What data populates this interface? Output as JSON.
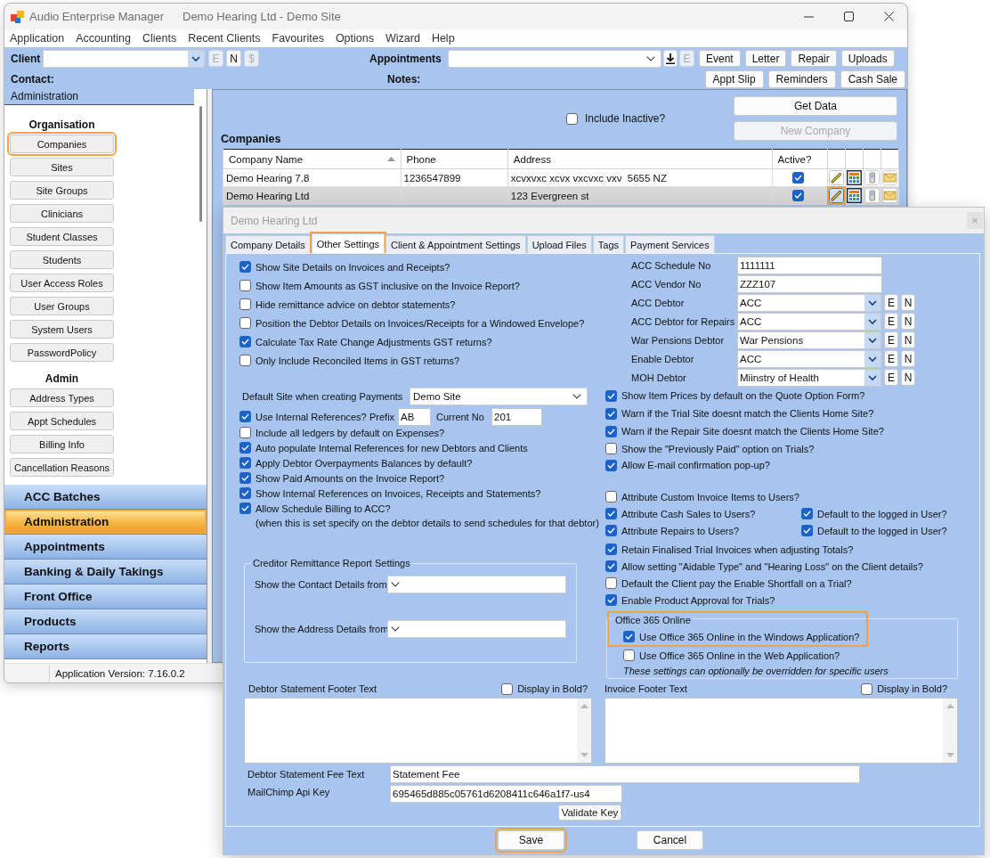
{
  "main_window": {
    "app_title": "Audio Enterprise Manager",
    "document_title": "Demo Hearing Ltd - Demo Site"
  },
  "menu": [
    "Application",
    "Accounting",
    "Clients",
    "Recent Clients",
    "Favourites",
    "Options",
    "Wizard",
    "Help"
  ],
  "toolbar": {
    "client_label": "Client",
    "client_buttons": [
      {
        "label": "E",
        "disabled": true
      },
      {
        "label": "N",
        "disabled": false
      },
      {
        "label": "$",
        "disabled": true
      }
    ],
    "appointments_label": "Appointments",
    "appointment_buttons": [
      {
        "kind": "download",
        "disabled": false
      },
      {
        "kind": "letter",
        "label": "E",
        "disabled": true
      }
    ],
    "buttons": [
      "Event",
      "Letter",
      "Repair",
      "Uploads"
    ],
    "contact_label": "Contact:",
    "notes_label": "Notes:",
    "buttons_row_2": [
      "Appt Slip",
      "Reminders",
      "Cash Sale"
    ]
  },
  "sidebar": {
    "header": "Administration",
    "groups": [
      {
        "heading": "Organisation",
        "items": [
          {
            "label": "Companies",
            "highlighted": true
          },
          {
            "label": "Sites",
            "highlighted": false
          },
          {
            "label": "Site Groups",
            "highlighted": false
          },
          {
            "label": "Clinicians",
            "highlighted": false
          },
          {
            "label": "Student Classes",
            "highlighted": false
          },
          {
            "label": "Students",
            "highlighted": false
          },
          {
            "label": "User Access Roles",
            "highlighted": false
          },
          {
            "label": "User Groups",
            "highlighted": false
          },
          {
            "label": "System Users",
            "highlighted": false
          },
          {
            "label": "PasswordPolicy",
            "highlighted": false
          }
        ]
      },
      {
        "heading": "Admin",
        "items": [
          {
            "label": "Address Types",
            "highlighted": false
          },
          {
            "label": "Appt Schedules",
            "highlighted": false
          },
          {
            "label": "Billing Info",
            "highlighted": false
          },
          {
            "label": "Cancellation Reasons",
            "highlighted": false
          }
        ]
      }
    ],
    "nav": [
      {
        "label": "ACC Batches",
        "selected": false
      },
      {
        "label": "Administration",
        "selected": true
      },
      {
        "label": "Appointments",
        "selected": false
      },
      {
        "label": "Banking & Daily Takings",
        "selected": false
      },
      {
        "label": "Front Office",
        "selected": false
      },
      {
        "label": "Products",
        "selected": false
      },
      {
        "label": "Reports",
        "selected": false
      }
    ]
  },
  "status_bar": {
    "version": "Application Version: 7.16.0.2"
  },
  "companies": {
    "include_inactive": {
      "label": "Include Inactive?",
      "checked": false
    },
    "buttons": [
      {
        "label": "Get Data",
        "disabled": false
      },
      {
        "label": "New Company",
        "disabled": true
      }
    ],
    "title": "Companies",
    "columns": [
      {
        "label": "Company Name",
        "sorted": true
      },
      {
        "label": "Phone",
        "sorted": false
      },
      {
        "label": "Address",
        "sorted": false
      },
      {
        "label": "Active?",
        "sorted": false
      }
    ],
    "rows": [
      {
        "name": "Demo Hearing 7.8",
        "phone": "1236547899",
        "address": "xcvxvxc xcvx vxcvxc vxv  5655 NZ",
        "active": true,
        "selected": false,
        "edit_highlighted": false
      },
      {
        "name": "Demo Hearing Ltd",
        "address": "123 Evergreen st",
        "active": true,
        "selected": true,
        "edit_highlighted": true
      }
    ]
  },
  "dialog": {
    "title": "Demo Hearing Ltd",
    "tabs": [
      {
        "label": "Company Details",
        "selected": false,
        "highlighted": false
      },
      {
        "label": "Other Settings",
        "selected": true,
        "highlighted": true
      },
      {
        "label": "Client & Appointment Settings",
        "selected": false,
        "highlighted": false
      },
      {
        "label": "Upload Files",
        "selected": false,
        "highlighted": false
      },
      {
        "label": "Tags",
        "selected": false,
        "highlighted": false
      },
      {
        "label": "Payment Services",
        "selected": false,
        "highlighted": false
      }
    ],
    "invoice_options": [
      {
        "label": "Show Site Details on Invoices and Receipts?",
        "checked": true
      },
      {
        "label": "Show Item Amounts as GST inclusive on the Invoice Report?",
        "checked": false
      },
      {
        "label": "Hide remittance advice on debtor statements?",
        "checked": false
      },
      {
        "label": "Position the Debtor Details on Invoices/Receipts for a Windowed Envelope?",
        "checked": false
      },
      {
        "label": "Calculate Tax Rate Change Adjustments GST returns?",
        "checked": true
      },
      {
        "label": "Only Include Reconciled Items in GST returns?",
        "checked": false
      }
    ],
    "default_site": {
      "label": "Default Site when creating Payments",
      "value": "Demo Site"
    },
    "internal_references": {
      "label": "Use Internal References?",
      "checked": true,
      "prefix_label": "Prefix",
      "prefix": "AB",
      "current_label": "Current No",
      "current": "201"
    },
    "reference_options": [
      {
        "label": "Include all ledgers by default on Expenses?",
        "checked": false
      },
      {
        "label": "Auto populate Internal References for new Debtors and Clients",
        "checked": true
      },
      {
        "label": "Apply Debtor Overpayments Balances by default?",
        "checked": true
      },
      {
        "label": "Show Paid Amounts on the Invoice Report?",
        "checked": true
      },
      {
        "label": "Show Internal References on Invoices, Receipts and Statements?",
        "checked": true
      },
      {
        "label": "Allow Schedule Billing to ACC?",
        "checked": true
      }
    ],
    "schedule_note": "(when this is set specify on the debtor details to send schedules for that debtor)",
    "creditor_remittance": {
      "title": "Creditor Remittance Report Settings",
      "fields": [
        {
          "label": "Show the Contact Details from"
        },
        {
          "label": "Show the Address Details from"
        }
      ]
    },
    "acc_fields": [
      {
        "kind": "text",
        "label": "ACC Schedule No",
        "value": "1111111"
      },
      {
        "kind": "text",
        "label": "ACC Vendor No",
        "value": "ZZZ107"
      },
      {
        "kind": "combo",
        "label": "ACC Debtor",
        "value": "ACC",
        "buttons": [
          "E",
          "N"
        ]
      },
      {
        "kind": "combo",
        "label": "ACC Debtor for Repairs",
        "value": "ACC",
        "buttons": [
          "E",
          "N"
        ]
      },
      {
        "kind": "combo",
        "label": "War Pensions Debtor",
        "value": "War Pensions",
        "buttons": [
          "E",
          "N"
        ]
      },
      {
        "kind": "combo",
        "label": "Enable Debtor",
        "value": "ACC",
        "buttons": [
          "E",
          "N"
        ]
      },
      {
        "kind": "combo",
        "label": "MOH Debtor",
        "value": "Miinstry of Health",
        "buttons": [
          "E",
          "N"
        ]
      }
    ],
    "trial_options": [
      {
        "label": "Show Item Prices by default on the Quote Option Form?",
        "checked": true
      },
      {
        "label": "Warn if the Trial Site doesnt match the Clients Home Site?",
        "checked": true
      },
      {
        "label": "Warn if the Repair Site doesnt match the Clients Home Site?",
        "checked": true
      },
      {
        "label": "Show the \"Previously Paid\" option on Trials?",
        "checked": false
      },
      {
        "label": "Allow E-mail confirmation pop-up?",
        "checked": true
      }
    ],
    "user_options": [
      {
        "label": "Attribute Custom Invoice Items to Users?",
        "checked": false
      },
      {
        "label": "Attribute Cash Sales to Users?",
        "checked": true,
        "default_user": {
          "label": "Default to the logged in User?",
          "checked": true
        }
      },
      {
        "label": "Attribute Repairs to Users?",
        "checked": true,
        "default_user": {
          "label": "Default to the logged in User?",
          "checked": true
        }
      }
    ],
    "approval_options": [
      {
        "label": "Retain Finalised Trial Invoices when adjusting Totals?",
        "checked": true
      },
      {
        "label": "Allow setting \"Aidable Type\" and \"Hearing Loss\" on the Client details?",
        "checked": true
      },
      {
        "label": "Default the Client pay the Enable Shortfall on a Trial?",
        "checked": false
      },
      {
        "label": "Enable Product Approval for Trials?",
        "checked": true
      }
    ],
    "office365": {
      "title": "Office 365 Online",
      "highlighted": true,
      "options": [
        {
          "label": "Use Office 365 Online in the Windows Application?",
          "checked": true
        },
        {
          "label": "Use Office 365 Online in the Web Application?",
          "checked": false
        }
      ],
      "note": "These settings can optionally be overridden for specific users"
    },
    "footers": [
      {
        "label": "Debtor Statement Footer Text",
        "bold_label": "Display in Bold?",
        "bold": false
      },
      {
        "label": "Invoice Footer Text",
        "bold_label": "Display in Bold?",
        "bold": false
      }
    ],
    "fee_text": {
      "label": "Debtor Statement Fee Text",
      "value": "Statement Fee"
    },
    "mailchimp": {
      "label": "MailChimp Api Key",
      "value": "695465d885c05761d6208411c646a1f7-us4",
      "button": "Validate Key"
    },
    "buttons": [
      {
        "label": "Save",
        "highlighted": true
      },
      {
        "label": "Cancel",
        "highlighted": false
      }
    ]
  }
}
